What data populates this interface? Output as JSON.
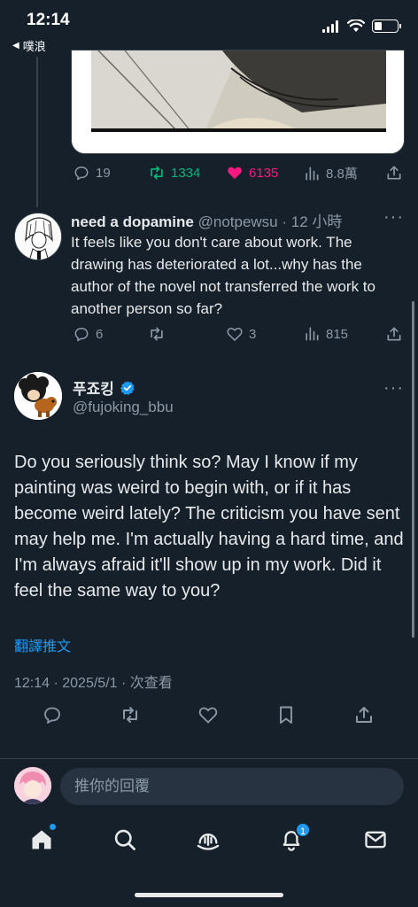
{
  "status_bar": {
    "time": "12:14",
    "back_app": "噗浪"
  },
  "colors": {
    "background": "#15202b",
    "accent": "#1d9bf0",
    "retweet": "#00ba7c",
    "like": "#f91880",
    "muted": "#8b98a5"
  },
  "parent_tweet": {
    "stats": {
      "replies": "19",
      "retweets": "1334",
      "likes": "6135",
      "views": "8.8萬"
    }
  },
  "reply_tweet": {
    "name": "need a dopamine",
    "handle": "@notpewsu",
    "time": "· 12 小時",
    "text": "It feels like you don't care about work. The drawing has deteriorated a lot...why has the author of the novel not transferred the work to another person so far?",
    "stats": {
      "replies": "6",
      "retweets": "",
      "likes": "3",
      "views": "815"
    }
  },
  "main_tweet": {
    "name": "푸죠킹",
    "handle": "@fujoking_bbu",
    "text": "Do you seriously think so? May I know if my painting was weird to begin with, or if it has become weird lately? The criticism you have sent may help me. I'm actually having a hard time, and I'm always afraid it'll show up in my work. Did it feel the same way to you?",
    "translate": "翻譯推文",
    "meta": "12:14 · 2025/5/1 · 次查看"
  },
  "reply_bar": {
    "placeholder": "推你的回覆"
  },
  "tab_bar": {
    "notifications_badge": "1"
  },
  "icons": [
    "reply-icon",
    "retweet-icon",
    "like-icon",
    "views-icon",
    "share-icon",
    "bookmark-icon",
    "verified-icon",
    "home-icon",
    "search-icon",
    "spaces-icon",
    "notifications-icon",
    "messages-icon"
  ]
}
